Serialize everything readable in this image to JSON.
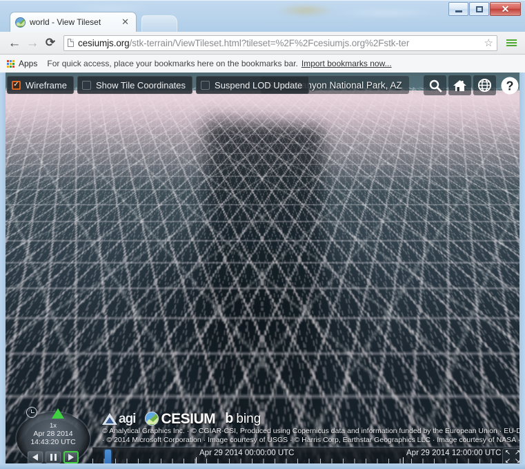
{
  "window": {
    "minimize_label": "–",
    "maximize_label": "□",
    "close_label": "✕"
  },
  "browser": {
    "tab": {
      "title": "world - View Tileset",
      "close_label": "✕",
      "favicon_name": "cesium-favicon"
    },
    "nav": {
      "back_label": "←",
      "forward_label": "→",
      "reload_label": "⟳"
    },
    "omnibox": {
      "host": "cesiumjs.org",
      "path": "/stk-terrain/ViewTileset.html?tileset=%2F%2Fcesiumjs.org%2Fstk-ter",
      "star_label": "☆"
    },
    "bookmarks": {
      "apps_label": "Apps",
      "hint": "For quick access, place your bookmarks here on the bookmarks bar.",
      "import_link": "Import bookmarks now..."
    }
  },
  "cesium_toolbar": {
    "checkboxes": [
      {
        "label": "Wireframe",
        "checked": true
      },
      {
        "label": "Show Tile Coordinates",
        "checked": false
      },
      {
        "label": "Suspend LOD Update",
        "checked": false
      }
    ],
    "search_value": "Grand Canyon National Park, AZ",
    "icons": [
      {
        "name": "search-icon",
        "label": "Search"
      },
      {
        "name": "home-icon",
        "label": "Home"
      },
      {
        "name": "globe-icon",
        "label": "Scene Mode"
      },
      {
        "name": "help-icon",
        "label": "?"
      }
    ]
  },
  "animation": {
    "speed": "1x",
    "date": "Apr 28 2014",
    "time": "14:43:20 UTC",
    "reverse_label": "◀",
    "pause_label": "❚❚",
    "play_label": "▶"
  },
  "credits": {
    "logos": [
      {
        "name": "agi-logo",
        "text": "agi"
      },
      {
        "name": "cesium-logo",
        "text": "CESIUM"
      },
      {
        "name": "bing-logo",
        "mark": "b",
        "text": "bing"
      }
    ],
    "line1": "© Analytical Graphics Inc. · © CGIAR-CSI, Produced using Copernicus data and information funded by the European Union · EU-D",
    "line2": "· © 2014 Microsoft Corporation · Image courtesy of USGS · © Harris Corp, Earthstar Geographics LLC · Image courtesy of NASA ·"
  },
  "timeline": {
    "label_left": "Apr 29 2014 00:00:00 UTC",
    "label_right": "Apr 29 2014 12:00:00 UTC",
    "fullscreen_glyphs": [
      "↖",
      "↗",
      "↙",
      "↘"
    ]
  }
}
